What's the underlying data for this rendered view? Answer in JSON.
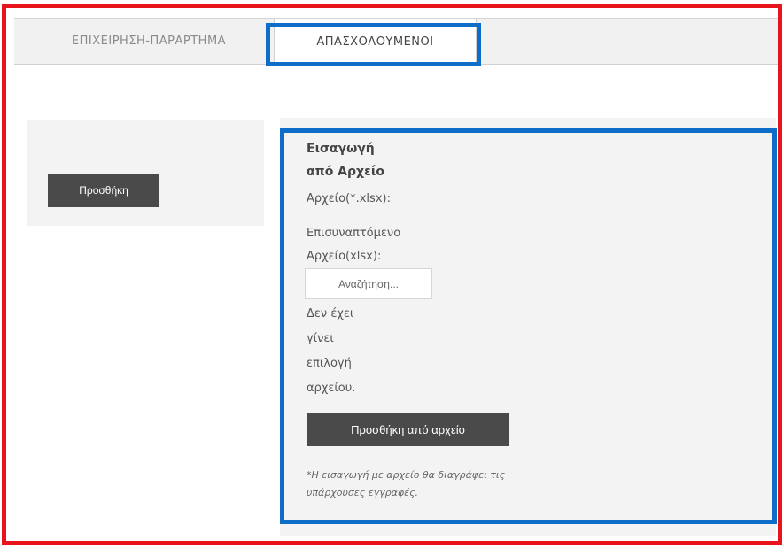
{
  "tabs": {
    "business": "ΕΠΙΧΕΙΡΗΣΗ-ΠΑΡΑΡΤΗΜΑ",
    "employees": "ΑΠΑΣΧΟΛΟΥΜΕΝΟΙ"
  },
  "left": {
    "add_label": "Προσθήκη"
  },
  "import": {
    "title_line1": "Εισαγωγή",
    "title_line2": "από Αρχείο",
    "file_label": "Αρχείο(*.xlsx):",
    "attached_line1": "Επισυναπτόμενο",
    "attached_line2": "Αρχείο(xlsx):",
    "browse_label": "Αναζήτηση...",
    "no_file_line1": "Δεν έχει",
    "no_file_line2": "γίνει",
    "no_file_line3": "επιλογή",
    "no_file_line4": "αρχείου.",
    "add_from_file_label": "Προσθήκη από αρχείο",
    "note_line1": "*Η εισαγωγή με αρχείο θα διαγράψει τις",
    "note_line2": "υπάρχουσες εγγραφές."
  },
  "colors": {
    "annotation_red": "#e8141b",
    "annotation_blue": "#0d6dc8",
    "button_dark": "#4a4a4a",
    "panel_bg": "#f3f3f3"
  }
}
